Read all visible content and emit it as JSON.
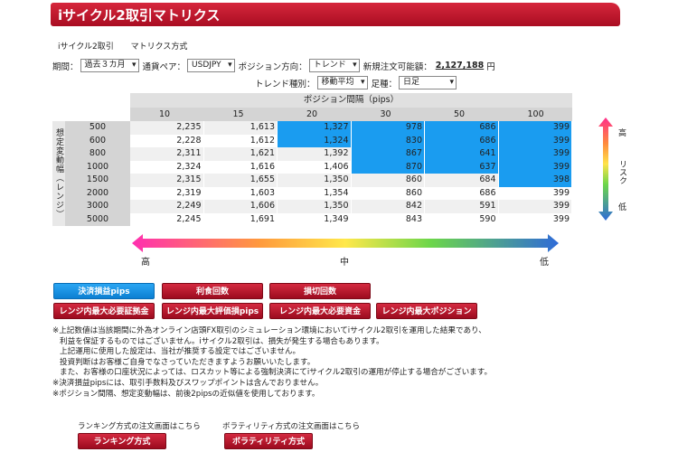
{
  "title": "iサイクル2取引マトリクス",
  "tabs": [
    "iサイクル2取引",
    "マトリクス方式"
  ],
  "controls": {
    "period_label": "期間：",
    "period_value": "過去３カ月",
    "pair_label": "通貨ペア：",
    "pair_value": "USDJPY",
    "direction_label": "ポジション方向：",
    "direction_value": "トレンド",
    "margin_label": "新規注文可能額：",
    "margin_value": "2,127,188",
    "margin_unit": "円",
    "trend_label": "トレンド種別：",
    "trend_value": "移動平均",
    "bar_label": "足種：",
    "bar_value": "日足"
  },
  "matrix": {
    "header": "ポジション間隔（pips）",
    "row_axis_label": "想定変動幅（レンジ）",
    "columns": [
      "10",
      "15",
      "20",
      "30",
      "50",
      "100"
    ],
    "rows": [
      {
        "label": "500",
        "values": [
          "2,235",
          "1,613",
          "1,327",
          "978",
          "686",
          "399"
        ]
      },
      {
        "label": "600",
        "values": [
          "2,228",
          "1,612",
          "1,324",
          "830",
          "686",
          "399"
        ]
      },
      {
        "label": "800",
        "values": [
          "2,311",
          "1,621",
          "1,392",
          "867",
          "641",
          "399"
        ]
      },
      {
        "label": "1000",
        "values": [
          "2,324",
          "1,616",
          "1,406",
          "870",
          "637",
          "399"
        ]
      },
      {
        "label": "1500",
        "values": [
          "2,315",
          "1,655",
          "1,350",
          "860",
          "684",
          "398"
        ]
      },
      {
        "label": "2000",
        "values": [
          "2,319",
          "1,603",
          "1,354",
          "860",
          "686",
          "399"
        ]
      },
      {
        "label": "3000",
        "values": [
          "2,249",
          "1,606",
          "1,350",
          "842",
          "591",
          "399"
        ]
      },
      {
        "label": "5000",
        "values": [
          "2,245",
          "1,691",
          "1,349",
          "843",
          "590",
          "399"
        ]
      }
    ],
    "highlight_color": "#1a9cf0"
  },
  "risk": {
    "high": "高",
    "label": "リスク",
    "low": "低"
  },
  "scale": {
    "high": "高",
    "mid": "中",
    "low": "低"
  },
  "buttons_row1": [
    "決済損益pips",
    "利食回数",
    "損切回数"
  ],
  "buttons_row2": [
    "レンジ内最大必要証拠金",
    "レンジ内最大評価損pips",
    "レンジ内最大必要資金",
    "レンジ内最大ポジション"
  ],
  "notes": [
    "※上記数値は当該期間に外為オンライン店頭FX取引のシミュレーション環境においてiサイクル2取引を運用した結果であり、",
    "利益を保証するものではございません。iサイクル2取引は、損失が発生する場合もあります。",
    "上記運用に使用した設定は、当社が推奨する設定ではございません。",
    "投資判断はお客様ご自身でなさっていただきますようお願いいたします。",
    "また、お客様の口座状況によっては、ロスカット等による強制決済にてiサイクル2取引の運用が停止する場合がございます。",
    "※決済損益pipsには、取引手数料及びスワップポイントは含んでおりません。",
    "※ポジション間隔、想定変動幅は、前後2pipsの近似値を使用しております。"
  ],
  "bottom": {
    "ranking_caption": "ランキング方式の注文画面はこちら",
    "ranking_button": "ランキング方式",
    "volatility_caption": "ボラティリティ方式の注文画面はこちら",
    "volatility_button": "ボラティリティ方式"
  }
}
